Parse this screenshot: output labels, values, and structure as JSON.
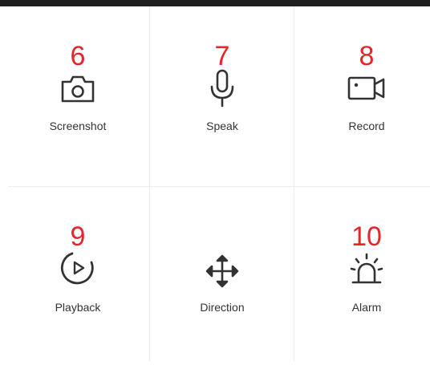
{
  "colors": {
    "accent_number": "#e8232a",
    "icon": "#333333",
    "divider": "#ececec",
    "topbar": "#1f1f1f"
  },
  "tiles": [
    {
      "number": "6",
      "label": "Screenshot",
      "icon": "camera-icon"
    },
    {
      "number": "7",
      "label": "Speak",
      "icon": "microphone-icon"
    },
    {
      "number": "8",
      "label": "Record",
      "icon": "video-camera-icon"
    },
    {
      "number": "9",
      "label": "Playback",
      "icon": "playback-icon"
    },
    {
      "number": "",
      "label": "Direction",
      "icon": "direction-arrows-icon"
    },
    {
      "number": "10",
      "label": "Alarm",
      "icon": "alarm-siren-icon"
    }
  ]
}
